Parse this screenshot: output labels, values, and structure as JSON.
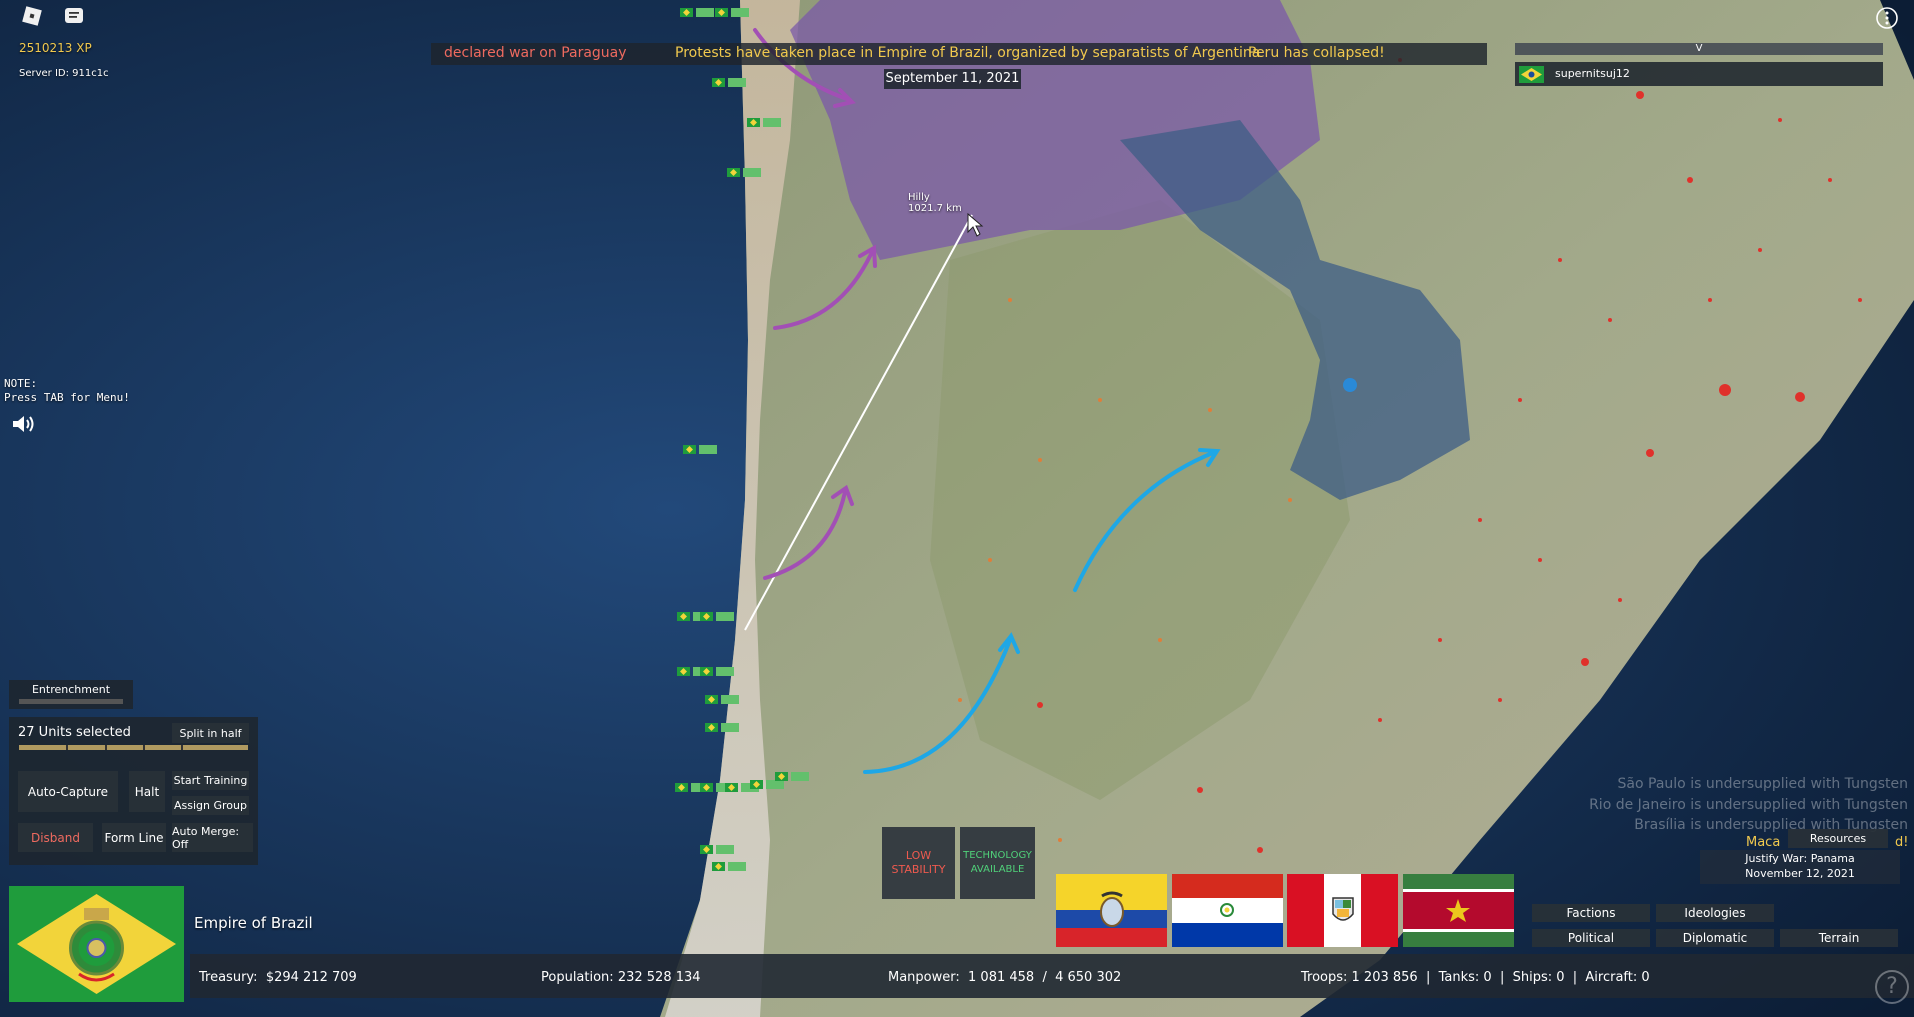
{
  "player": {
    "xp": "2510213 XP",
    "server_id": "Server ID: 911c1c",
    "username": "supernitsuj12",
    "country": "Empire of Brazil"
  },
  "news": [
    {
      "text": "declared war on Paraguay",
      "color": "red"
    },
    {
      "text": "Protests have taken place in Empire of Brazil, organized by separatists of Argentina",
      "color": "yellow"
    },
    {
      "text": "Peru has collapsed!",
      "color": "yellow"
    }
  ],
  "date": "September 11, 2021",
  "leaderboard": {
    "header": "V"
  },
  "note": {
    "line1": "NOTE:",
    "line2": "Press TAB for Menu!"
  },
  "map_labels": {
    "terrain": "Hilly",
    "distance": "1021.7 km"
  },
  "entrenchment": {
    "label": "Entrenchment",
    "level": 0.0
  },
  "units": {
    "selected": "27 Units selected",
    "split": "Split in half",
    "buttons": {
      "auto_capture": "Auto-Capture",
      "halt": "Halt",
      "start_training": "Start Training",
      "assign_group": "Assign Group",
      "disband": "Disband",
      "form_line": "Form Line",
      "auto_merge": "Auto Merge: Off"
    }
  },
  "alerts": {
    "low_stability": [
      "LOW",
      "STABILITY"
    ],
    "technology": [
      "TECHNOLOGY",
      "AVAILABLE"
    ]
  },
  "undersupplied": [
    "São Paulo is undersupplied with Tungsten",
    "Rio de Janeiro is undersupplied with Tungsten",
    "Brasília is undersupplied with Tungsten"
  ],
  "resources": {
    "title": "Resources",
    "partial_left": "Maca",
    "partial_right": "d!",
    "justify": "Justify War: Panama",
    "date": "November 12, 2021"
  },
  "menu": {
    "factions": "Factions",
    "ideologies": "Ideologies",
    "political": "Political",
    "diplomatic": "Diplomatic",
    "terrain": "Terrain"
  },
  "stats": {
    "treasury_label": "Treasury:",
    "treasury": "$294 212 709",
    "population_label": "Population:",
    "population": "232 528 134",
    "manpower_label": "Manpower:",
    "manpower": "1 081 458  /  4 650 302",
    "troops": "Troops: 1 203 856  |  Tanks: 0  |  Ships: 0  |  Aircraft: 0"
  },
  "help": "?",
  "colors": {
    "news_yellow": "#f1c94e",
    "news_red": "#ee6a5f",
    "brazil_green": "#1f9c3c",
    "brazil_yellow": "#f2d43a",
    "unit_label": "#63c06c",
    "arrow_purple": "#a24fb5",
    "arrow_blue": "#1ea7e6"
  },
  "icons": [
    "roblox-logo-icon",
    "chat-icon",
    "menu-dots-icon",
    "speaker-icon",
    "help-icon",
    "cursor-icon"
  ]
}
